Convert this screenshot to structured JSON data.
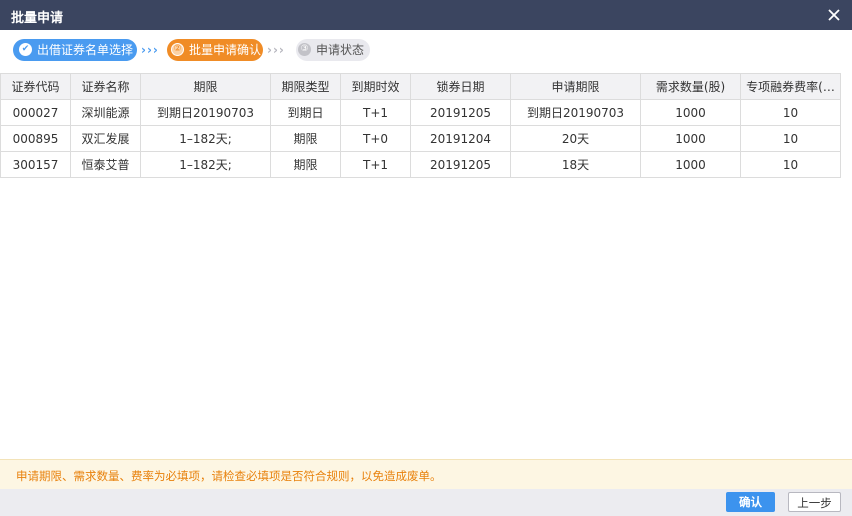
{
  "dialog": {
    "title": "批量申请",
    "close_icon": "close-icon",
    "colors": {
      "titlebar": "#3b4560",
      "step_done": "#4a9bf0",
      "step_current": "#f08c26",
      "notice_text": "#e8810c",
      "primary_button": "#3c93ee"
    }
  },
  "steps": {
    "items": [
      {
        "num": "✔",
        "label": "出借证券名单选择",
        "state": "done"
      },
      {
        "num": "②",
        "label": "批量申请确认",
        "state": "current"
      },
      {
        "num": "③",
        "label": "申请状态",
        "state": "pending"
      }
    ],
    "separator": "›››"
  },
  "table": {
    "columns": [
      "证券代码",
      "证券名称",
      "期限",
      "期限类型",
      "到期时效",
      "锁券日期",
      "申请期限",
      "需求数量(股)",
      "专项融券费率(…"
    ],
    "rows": [
      [
        "000027",
        "深圳能源",
        "到期日20190703",
        "到期日",
        "T+1",
        "20191205",
        "到期日20190703",
        "1000",
        "10"
      ],
      [
        "000895",
        "双汇发展",
        "1–182天;",
        "期限",
        "T+0",
        "20191204",
        "20天",
        "1000",
        "10"
      ],
      [
        "300157",
        "恒泰艾普",
        "1–182天;",
        "期限",
        "T+1",
        "20191205",
        "18天",
        "1000",
        "10"
      ]
    ]
  },
  "notice": {
    "text": "申请期限、需求数量、费率为必填项，请检查必填项是否符合规则，以免造成废单。"
  },
  "footer": {
    "confirm_label": "确认",
    "prev_label": "上一步"
  }
}
